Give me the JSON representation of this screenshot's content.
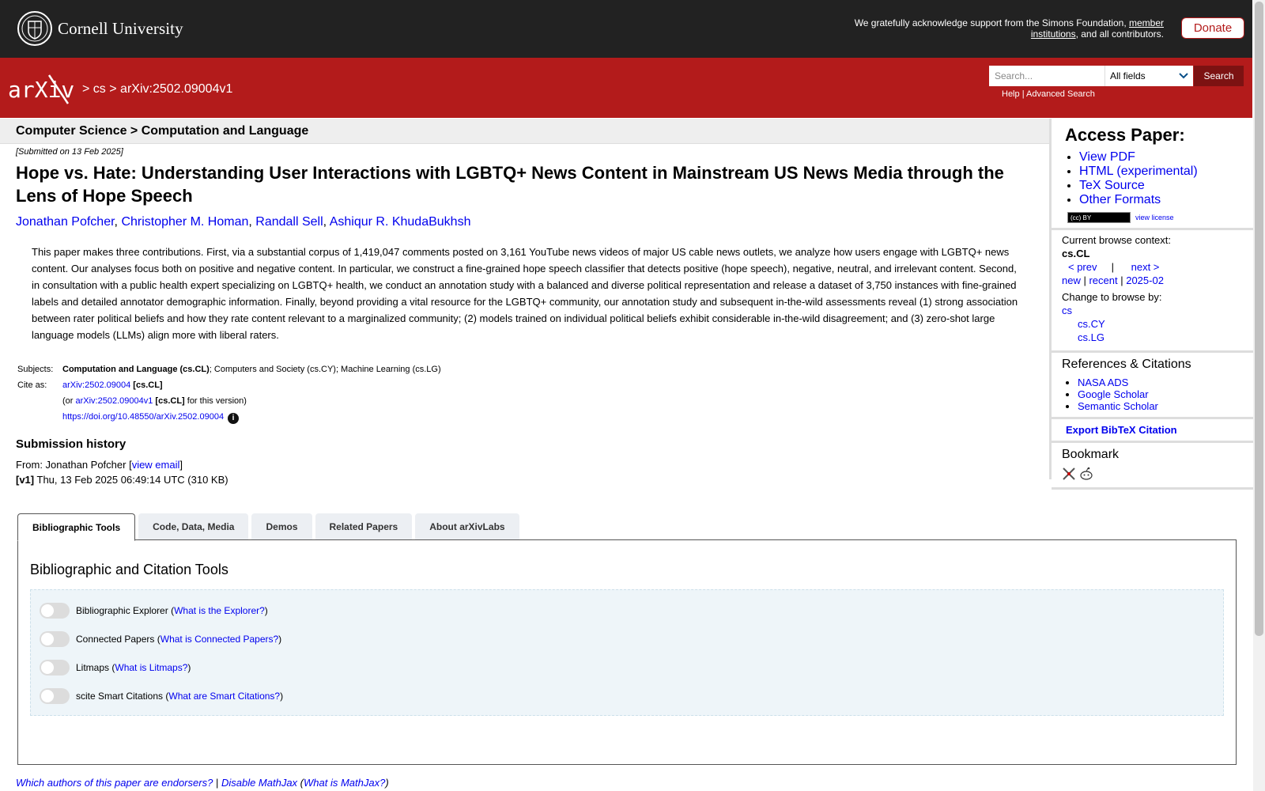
{
  "topbar": {
    "university": "Cornell University",
    "ack_prefix": "We gratefully acknowledge support from the Simons Foundation, ",
    "ack_link": "member institutions",
    "ack_suffix": ", and all contributors.",
    "donate": "Donate"
  },
  "header": {
    "logo_text": "arXiv",
    "crumb_sep1": ">",
    "crumb_cs": "cs",
    "crumb_sep2": ">",
    "crumb_id": "arXiv:2502.09004v1",
    "search_placeholder": "Search...",
    "search_field": "All fields",
    "search_button": "Search",
    "help": "Help",
    "help_sep": "|",
    "advanced": "Advanced Search"
  },
  "subheader": "Computer Science > Computation and Language",
  "paper": {
    "submitted": "[Submitted on 13 Feb 2025]",
    "title": "Hope vs. Hate: Understanding User Interactions with LGBTQ+ News Content in Mainstream US News Media through the Lens of Hope Speech",
    "authors": [
      "Jonathan Pofcher",
      "Christopher M. Homan",
      "Randall Sell",
      "Ashiqur R. KhudaBukhsh"
    ],
    "abstract": "This paper makes three contributions. First, via a substantial corpus of 1,419,047 comments posted on 3,161 YouTube news videos of major US cable news outlets, we analyze how users engage with LGBTQ+ news content. Our analyses focus both on positive and negative content. In particular, we construct a fine-grained hope speech classifier that detects positive (hope speech), negative, neutral, and irrelevant content. Second, in consultation with a public health expert specializing on LGBTQ+ health, we conduct an annotation study with a balanced and diverse political representation and release a dataset of 3,750 instances with fine-grained labels and detailed annotator demographic information. Finally, beyond providing a vital resource for the LGBTQ+ community, our annotation study and subsequent in-the-wild assessments reveal (1) strong association between rater political beliefs and how they rate content relevant to a marginalized community; (2) models trained on individual political beliefs exhibit considerable in-the-wild disagreement; and (3) zero-shot large language models (LLMs) align more with liberal raters.",
    "subjects_label": "Subjects:",
    "subjects_primary": "Computation and Language (cs.CL)",
    "subjects_rest": "; Computers and Society (cs.CY); Machine Learning (cs.LG)",
    "cite_label": "Cite as:",
    "cite_id": "arXiv:2502.09004",
    "cite_cat": "[cs.CL]",
    "cite_or": "(or ",
    "cite_version_id": "arXiv:2502.09004v1",
    "cite_version_cat": "[cs.CL]",
    "cite_version_suffix": " for this version)",
    "doi": "https://doi.org/10.48550/arXiv.2502.09004",
    "history_title": "Submission history",
    "from_prefix": "From: Jonathan Pofcher [",
    "view_email": "view email",
    "from_suffix": "]",
    "version_tag": "[v1]",
    "version_info": " Thu, 13 Feb 2025 06:49:14 UTC (310 KB)"
  },
  "sidebar": {
    "access_title": "Access Paper:",
    "access_links": [
      "View PDF",
      "HTML (experimental)",
      "TeX Source",
      "Other Formats"
    ],
    "cc_text": "(cc) BY",
    "view_license": "view license",
    "browse_label": "Current browse context:",
    "browse_ctx": "cs.CL",
    "prev": "< prev",
    "pipe": "|",
    "next": "next >",
    "new": "new",
    "recent": "recent",
    "month": "2025-02",
    "change_label": "Change to browse by:",
    "browse_cs": "cs",
    "browse_cy": "cs.CY",
    "browse_lg": "cs.LG",
    "refs_title": "References & Citations",
    "refs": [
      "NASA ADS",
      "Google Scholar",
      "Semantic Scholar"
    ],
    "bibtex": "Export BibTeX Citation",
    "bookmark": "Bookmark"
  },
  "tabs": [
    "Bibliographic Tools",
    "Code, Data, Media",
    "Demos",
    "Related Papers",
    "About arXivLabs"
  ],
  "panel": {
    "title": "Bibliographic and Citation Tools",
    "tools": [
      {
        "name": "Bibliographic Explorer",
        "help": "What is the Explorer?"
      },
      {
        "name": "Connected Papers",
        "help": "What is Connected Papers?"
      },
      {
        "name": "Litmaps",
        "help": "What is Litmaps?"
      },
      {
        "name": "scite Smart Citations",
        "help": "What are Smart Citations?"
      }
    ]
  },
  "footer": {
    "endorsers": "Which authors of this paper are endorsers?",
    "sep": "|",
    "disable": "Disable MathJax",
    "what": "What is MathJax?"
  },
  "colors": {
    "brand_red": "#b31b1b",
    "topbar": "#222222",
    "link": "#0000ee"
  }
}
